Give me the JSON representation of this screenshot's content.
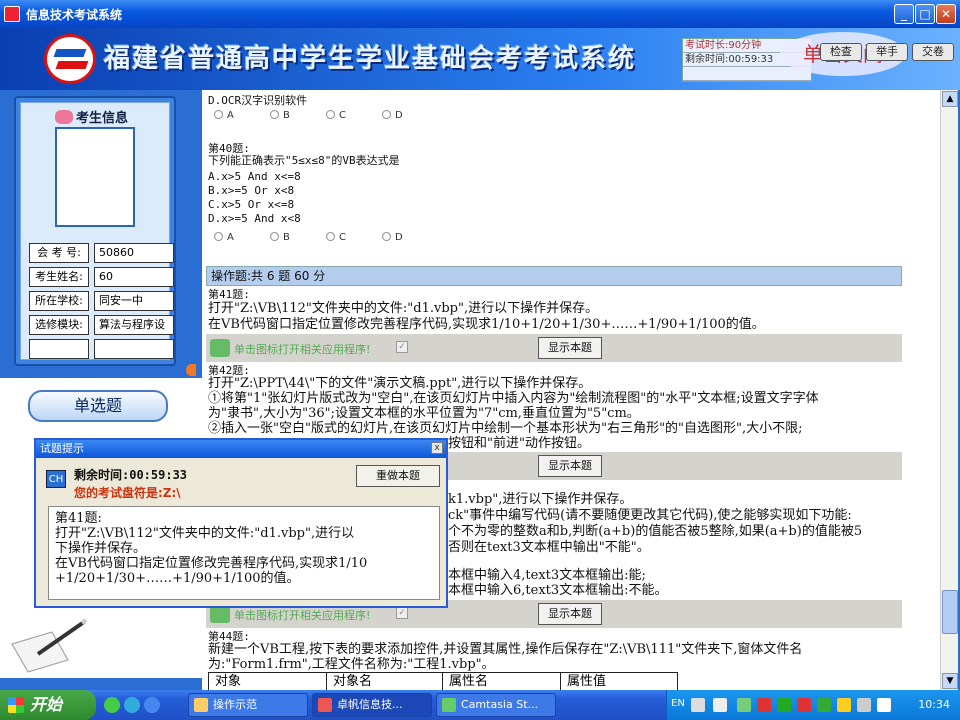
{
  "window": {
    "title": "信息技术考试系统",
    "min": "_",
    "max": "□",
    "close": "✕"
  },
  "header": {
    "system_title": "福建省普通高中学生学业基础会考考试系统",
    "close_hint": "单击关闭",
    "duration": "考试时长:90分钟",
    "remaining": "剩余时间:00:59:33",
    "btn_check": "检查",
    "btn_raise_hand": "举手",
    "btn_submit": "交卷"
  },
  "student": {
    "title": "考生信息",
    "rows": [
      {
        "label": "会 考 号:",
        "value": "50860"
      },
      {
        "label": "考生姓名:",
        "value": "60"
      },
      {
        "label": "所在学校:",
        "value": "同安一中"
      },
      {
        "label": "选修模块:",
        "value": "算法与程序设"
      },
      {
        "label": "",
        "value": ""
      }
    ]
  },
  "left_nav": {
    "single_choice": "单选题"
  },
  "questions": {
    "q39_option_d": "D.OCR汉字识别软件",
    "radios": [
      "A",
      "B",
      "C",
      "D"
    ],
    "q40_no": "第40题:",
    "q40_stem": "下列能正确表示\"5≤x≤8\"的VB表达式是",
    "q40_a": "A.x>5 And x<=8",
    "q40_b": "B.x>=5 Or x<8",
    "q40_c": "C.x>5 Or x<=8",
    "q40_d": "D.x>=5 And x<8",
    "op_header": "操作题:共 6 题 60 分",
    "q41_no": "第41题:",
    "q41_l1": "打开\"Z:\\VB\\112\"文件夹中的文件:\"d1.vbp\",进行以下操作并保存。",
    "q41_l2": "在VB代码窗口指定位置修改完善程序代码,实现求1/10+1/20+1/30+……+1/90+1/100的值。",
    "open_app_label": "单击图标打开相关应用程序!",
    "show_btn": "显示本题",
    "q42_no": "第42题:",
    "q42_l1": "打开\"Z:\\PPT\\44\\\"下的文件\"演示文稿.ppt\",进行以下操作并保存。",
    "q42_l2": "①将第\"1\"张幻灯片版式改为\"空白\",在该页幻灯片中插入内容为\"绘制流程图\"的\"水平\"文本框;设置文字字体",
    "q42_l3": "为\"隶书\",大小为\"36\";设置文本框的水平位置为\"7\"cm,垂直位置为\"5\"cm。",
    "q42_l4": "②插入一张\"空白\"版式的幻灯片,在该页幻灯片中绘制一个基本形状为\"右三角形\"的\"自选图形\",大小不限;",
    "q42_l5": "按钮和\"前进\"动作按钮。",
    "q43_l1": "k1.vbp\",进行以下操作并保存。",
    "q43_l2": "ck\"事件中编写代码(请不要随便更改其它代码),使之能够实现如下功能:",
    "q43_l3": "个不为零的整数a和b,判断(a+b)的值能否被5整除,如果(a+b)的值能被5",
    "q43_l4": "否则在text3文本框中输出\"不能\"。",
    "q43_l5": "本框中输入4,text3文本框输出:能;",
    "q43_l6": "本框中输入6,text3文本框输出:不能。",
    "q44_no": "第44题:",
    "q44_l1": "新建一个VB工程,按下表的要求添加控件,并设置其属性,操作后保存在\"Z:\\VB\\111\"文件夹下,窗体文件名",
    "q44_l2": "为:\"Form1.frm\",工程文件名称为:\"工程1.vbp\"。",
    "table_headers": [
      "对象",
      "对象名",
      "属性名",
      "属性值"
    ]
  },
  "dialog": {
    "title": "试题提示",
    "icon_text": "CH",
    "remaining": "剩余时间:00:59:33",
    "disk": "您的考试盘符是:Z:\\",
    "redo": "重做本题",
    "body_l1": "第41题:",
    "body_l2": "打开\"Z:\\VB\\112\"文件夹中的文件:\"d1.vbp\",进行以",
    "body_l3": "下操作并保存。",
    "body_l4": "在VB代码窗口指定位置修改完善程序代码,实现求1/10",
    "body_l5": "+1/20+1/30+……+1/90+1/100的值。",
    "close": "x"
  },
  "taskbar": {
    "start": "开始",
    "tasks": [
      "操作示范",
      "卓帆信息技...",
      "Camtasia St..."
    ],
    "lang": "EN",
    "clock": "10:34"
  }
}
